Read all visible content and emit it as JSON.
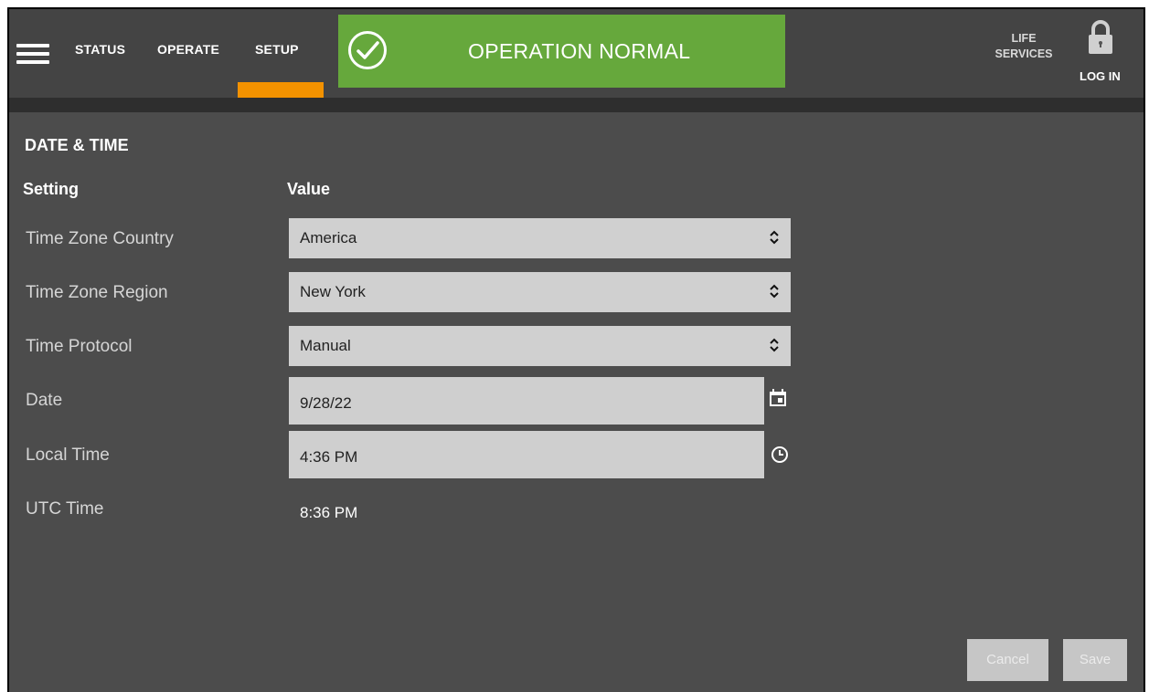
{
  "nav": {
    "tabs": [
      {
        "label": "STATUS"
      },
      {
        "label": "OPERATE"
      },
      {
        "label": "SETUP",
        "active": true
      }
    ],
    "banner": "OPERATION NORMAL",
    "life_services_line1": "LIFE",
    "life_services_line2": "SERVICES",
    "login": "LOG IN"
  },
  "page": {
    "title": "DATE & TIME",
    "col_setting": "Setting",
    "col_value": "Value"
  },
  "rows": [
    {
      "label": "Time Zone Country",
      "value": "America"
    },
    {
      "label": "Time Zone Region",
      "value": "New York"
    },
    {
      "label": "Time Protocol",
      "value": "Manual"
    },
    {
      "label": "Date",
      "value": "9/28/22"
    },
    {
      "label": "Local Time",
      "value": "4:36 PM"
    },
    {
      "label": "UTC Time",
      "value": "8:36 PM"
    }
  ],
  "buttons": {
    "cancel": "Cancel",
    "save": "Save"
  },
  "colors": {
    "banner_green": "#66a83c",
    "active_tab_accent": "#f39200",
    "background": "#4c4c4c"
  },
  "icons": [
    "menu-icon",
    "check-circle-icon",
    "lock-icon",
    "select-chevron-icon",
    "calendar-icon",
    "clock-icon"
  ]
}
